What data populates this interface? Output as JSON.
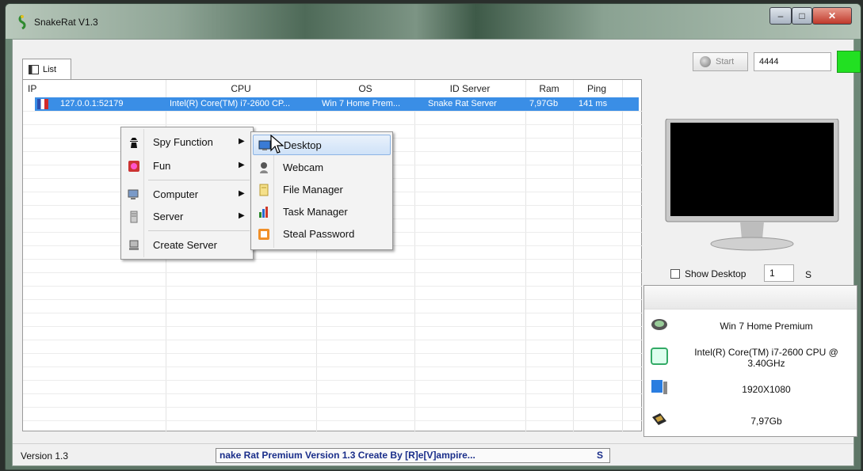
{
  "window": {
    "title": "SnakeRat V1.3",
    "controls": {
      "minimize": "–",
      "maximize": "□",
      "close": "✕"
    }
  },
  "tab": {
    "label": "List",
    "icon": "list-icon"
  },
  "toolbar": {
    "start_label": "Start",
    "port_value": "4444",
    "status_color": "#22e022"
  },
  "table": {
    "columns": [
      "IP",
      "CPU",
      "OS",
      "ID Server",
      "Ram",
      "Ping"
    ],
    "rows": [
      {
        "ip": "127.0.0.1:52179",
        "cpu": "Intel(R) Core(TM) i7-2600 CP...",
        "os": "Win 7 Home Prem...",
        "id_server": "Snake Rat Server",
        "ram": "7,97Gb",
        "ping": "141 ms"
      }
    ]
  },
  "context_menu": {
    "items": [
      {
        "label": "Spy Function",
        "icon": "spy-icon",
        "has_submenu": true
      },
      {
        "label": "Fun",
        "icon": "fun-icon",
        "has_submenu": true
      },
      {
        "label": "Computer",
        "icon": "computer-icon",
        "has_submenu": true
      },
      {
        "label": "Server",
        "icon": "server-icon",
        "has_submenu": true
      },
      {
        "label": "Create Server",
        "icon": "create-server-icon",
        "has_submenu": false
      }
    ],
    "submenu": {
      "items": [
        {
          "label": "Desktop",
          "icon": "desktop-icon",
          "highlighted": true
        },
        {
          "label": "Webcam",
          "icon": "webcam-icon"
        },
        {
          "label": "File Manager",
          "icon": "file-manager-icon"
        },
        {
          "label": "Task Manager",
          "icon": "task-manager-icon"
        },
        {
          "label": "Steal Password",
          "icon": "password-icon"
        }
      ]
    }
  },
  "desktop_preview": {
    "show_desktop_label": "Show Desktop",
    "checked": false,
    "interval_value": "1",
    "interval_unit": "S"
  },
  "info": {
    "os": "Win 7 Home Premium",
    "cpu": "Intel(R) Core(TM) i7-2600 CPU @ 3.40GHz",
    "resolution": "1920X1080",
    "ram": "7,97Gb"
  },
  "status_bar": {
    "version": "Version 1.3",
    "marquee": "nake Rat Premium Version 1.3    Create By [R]e[V]ampire...",
    "marquee_tail": "S"
  }
}
